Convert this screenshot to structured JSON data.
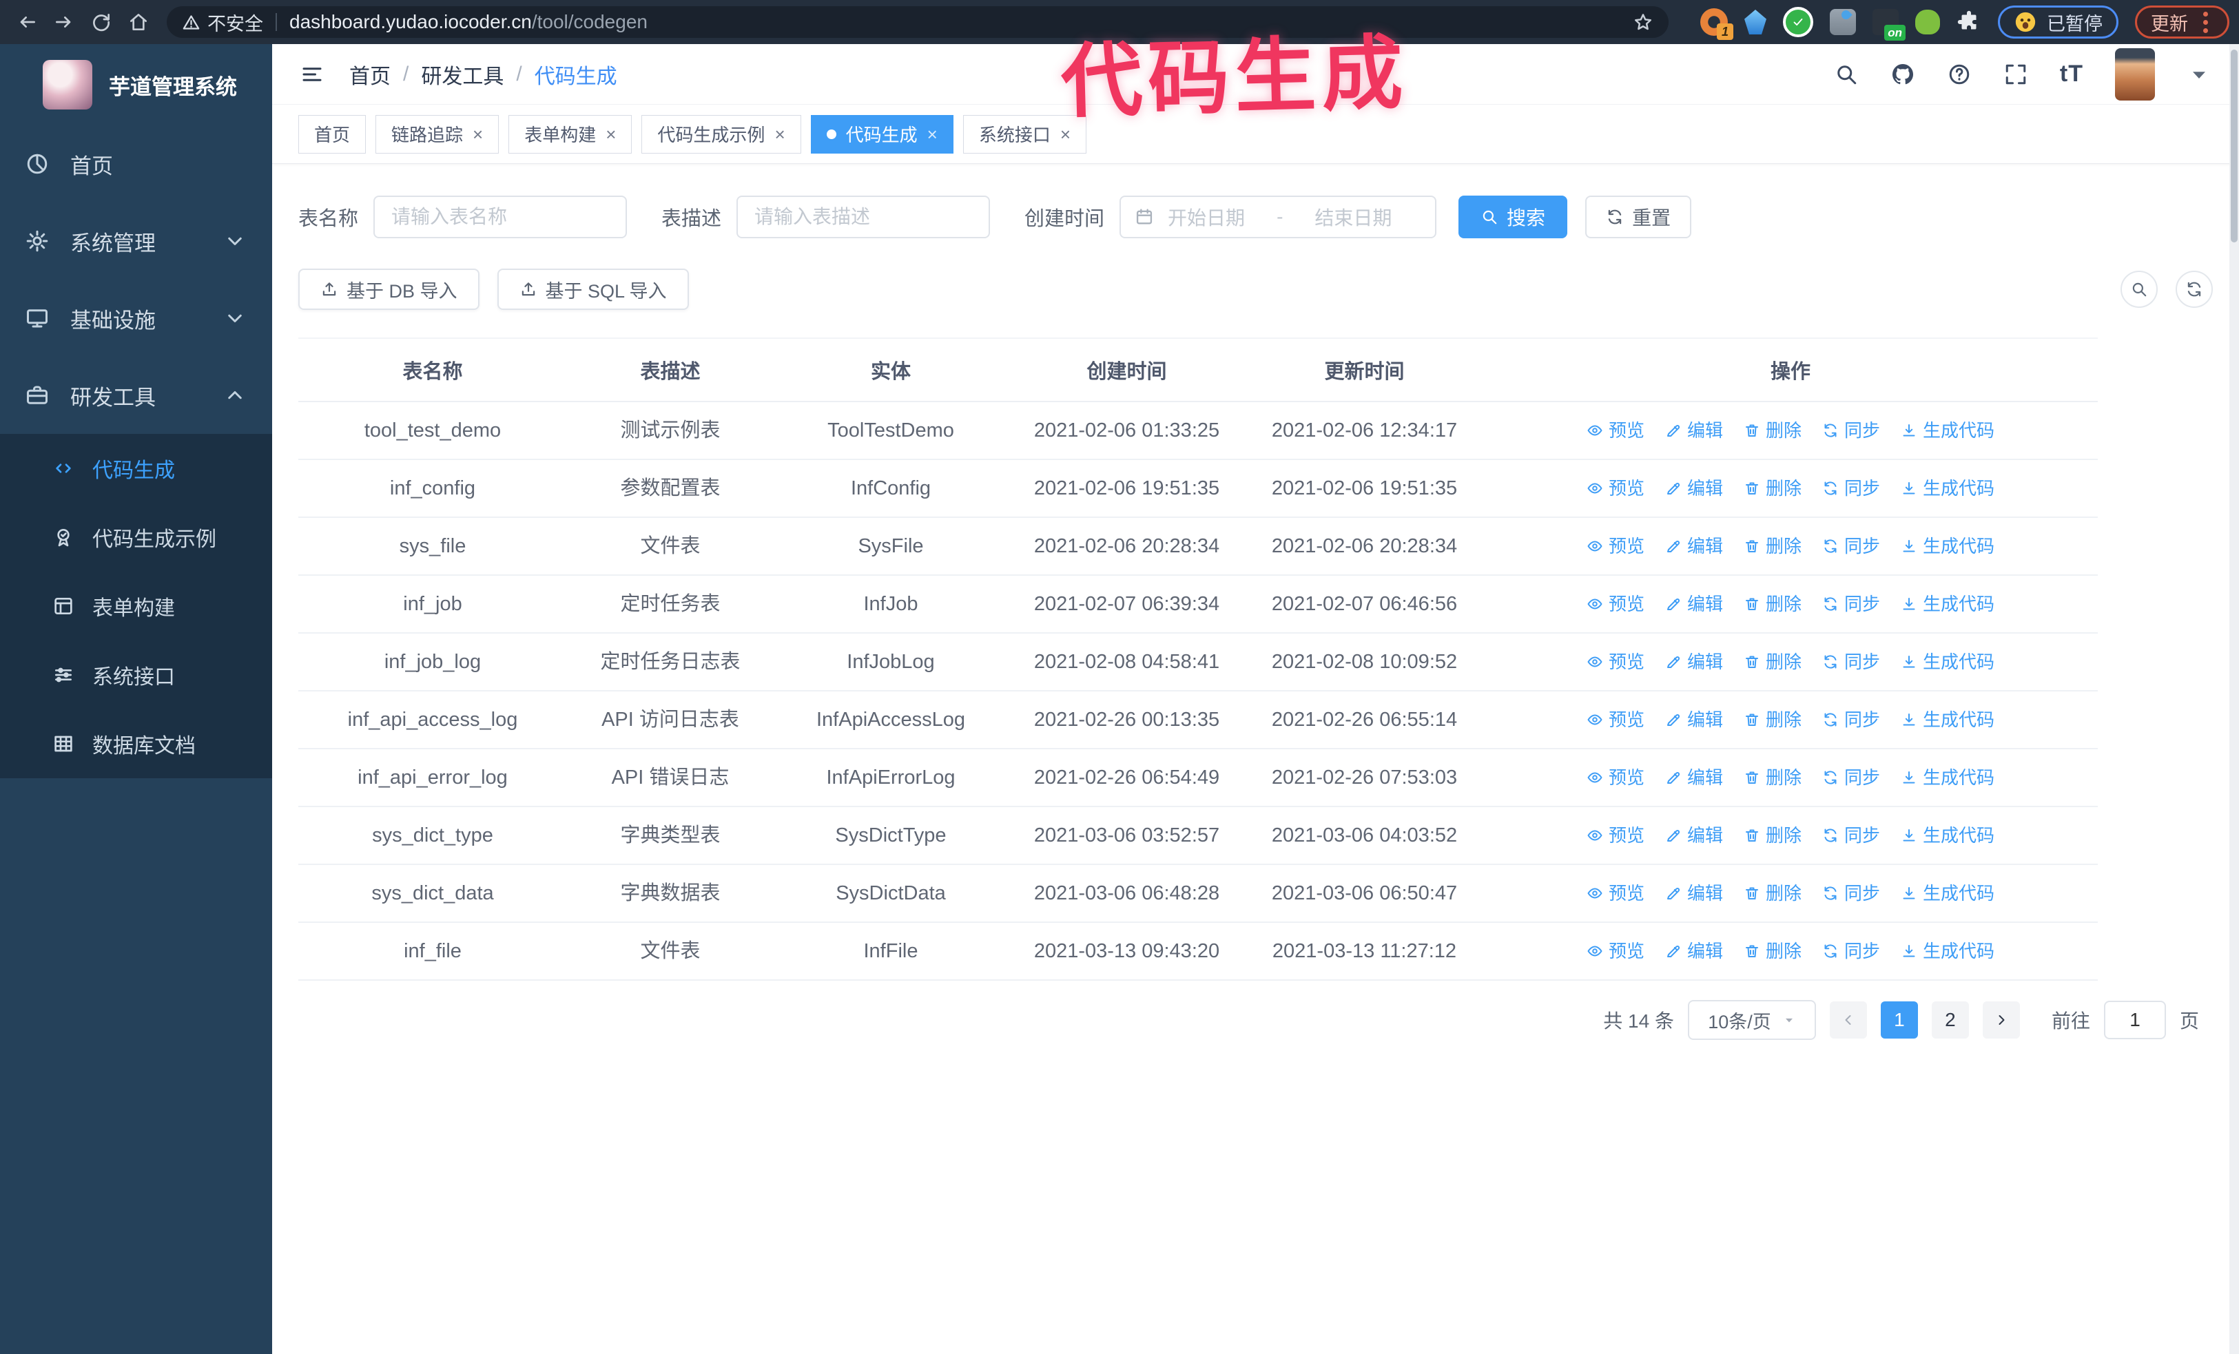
{
  "browser": {
    "security_label": "不安全",
    "url_domain": "dashboard.yudao.iocoder.cn",
    "url_path": "/tool/codegen",
    "extension_badge": "1",
    "extension_on_label": "on",
    "paused_label": "已暂停",
    "update_label": "更新"
  },
  "annotation": {
    "text": "代码生成",
    "color": "#f0365f"
  },
  "colors": {
    "accent": "#409eff",
    "sidebar_bg": "#25415a",
    "submenu_bg": "#1b3044"
  },
  "sidebar": {
    "logo_title": "芋道管理系统",
    "items": [
      {
        "id": "home",
        "label": "首页",
        "icon": "dashboard-icon"
      },
      {
        "id": "system",
        "label": "系统管理",
        "icon": "gear-icon",
        "chevron": "down"
      },
      {
        "id": "infra",
        "label": "基础设施",
        "icon": "monitor-icon",
        "chevron": "down"
      },
      {
        "id": "devtools",
        "label": "研发工具",
        "icon": "toolbox-icon",
        "chevron": "up",
        "submenu": [
          {
            "id": "codegen",
            "label": "代码生成",
            "icon": "code-icon",
            "active": true
          },
          {
            "id": "codegen-example",
            "label": "代码生成示例",
            "icon": "medal-icon"
          },
          {
            "id": "form-builder",
            "label": "表单构建",
            "icon": "form-icon"
          },
          {
            "id": "system-api",
            "label": "系统接口",
            "icon": "sliders-icon"
          },
          {
            "id": "db-doc",
            "label": "数据库文档",
            "icon": "database-icon"
          }
        ]
      }
    ]
  },
  "header": {
    "breadcrumb": [
      "首页",
      "研发工具",
      "代码生成"
    ]
  },
  "tabs": [
    {
      "label": "首页",
      "closable": false
    },
    {
      "label": "链路追踪",
      "closable": true
    },
    {
      "label": "表单构建",
      "closable": true
    },
    {
      "label": "代码生成示例",
      "closable": true
    },
    {
      "label": "代码生成",
      "closable": true,
      "active": true
    },
    {
      "label": "系统接口",
      "closable": true
    }
  ],
  "search": {
    "table_name_label": "表名称",
    "table_name_placeholder": "请输入表名称",
    "table_desc_label": "表描述",
    "table_desc_placeholder": "请输入表描述",
    "create_time_label": "创建时间",
    "date_start_placeholder": "开始日期",
    "date_separator": "-",
    "date_end_placeholder": "结束日期",
    "search_label": "搜索",
    "reset_label": "重置"
  },
  "toolbar": {
    "import_db_label": "基于 DB 导入",
    "import_sql_label": "基于 SQL 导入"
  },
  "table": {
    "columns": [
      "表名称",
      "表描述",
      "实体",
      "创建时间",
      "更新时间",
      "操作"
    ],
    "actions": [
      {
        "id": "preview",
        "label": "预览",
        "icon": "eye-icon"
      },
      {
        "id": "edit",
        "label": "编辑",
        "icon": "edit-icon"
      },
      {
        "id": "delete",
        "label": "删除",
        "icon": "delete-icon"
      },
      {
        "id": "sync",
        "label": "同步",
        "icon": "sync-icon"
      },
      {
        "id": "generate",
        "label": "生成代码",
        "icon": "download-icon"
      }
    ],
    "rows": [
      {
        "name": "tool_test_demo",
        "desc": "测试示例表",
        "entity": "ToolTestDemo",
        "create_time": "2021-02-06 01:33:25",
        "update_time": "2021-02-06 12:34:17"
      },
      {
        "name": "inf_config",
        "desc": "参数配置表",
        "entity": "InfConfig",
        "create_time": "2021-02-06 19:51:35",
        "update_time": "2021-02-06 19:51:35"
      },
      {
        "name": "sys_file",
        "desc": "文件表",
        "entity": "SysFile",
        "create_time": "2021-02-06 20:28:34",
        "update_time": "2021-02-06 20:28:34"
      },
      {
        "name": "inf_job",
        "desc": "定时任务表",
        "entity": "InfJob",
        "create_time": "2021-02-07 06:39:34",
        "update_time": "2021-02-07 06:46:56"
      },
      {
        "name": "inf_job_log",
        "desc": "定时任务日志表",
        "entity": "InfJobLog",
        "create_time": "2021-02-08 04:58:41",
        "update_time": "2021-02-08 10:09:52"
      },
      {
        "name": "inf_api_access_log",
        "desc": "API 访问日志表",
        "entity": "InfApiAccessLog",
        "create_time": "2021-02-26 00:13:35",
        "update_time": "2021-02-26 06:55:14"
      },
      {
        "name": "inf_api_error_log",
        "desc": "API 错误日志",
        "entity": "InfApiErrorLog",
        "create_time": "2021-02-26 06:54:49",
        "update_time": "2021-02-26 07:53:03"
      },
      {
        "name": "sys_dict_type",
        "desc": "字典类型表",
        "entity": "SysDictType",
        "create_time": "2021-03-06 03:52:57",
        "update_time": "2021-03-06 04:03:52"
      },
      {
        "name": "sys_dict_data",
        "desc": "字典数据表",
        "entity": "SysDictData",
        "create_time": "2021-03-06 06:48:28",
        "update_time": "2021-03-06 06:50:47"
      },
      {
        "name": "inf_file",
        "desc": "文件表",
        "entity": "InfFile",
        "create_time": "2021-03-13 09:43:20",
        "update_time": "2021-03-13 11:27:12"
      }
    ]
  },
  "pagination": {
    "total": "共 14 条",
    "page_size": "10条/页",
    "pages": [
      "1",
      "2"
    ],
    "active_page": "1",
    "goto_label": "前往",
    "goto_value": "1",
    "unit_label": "页"
  }
}
